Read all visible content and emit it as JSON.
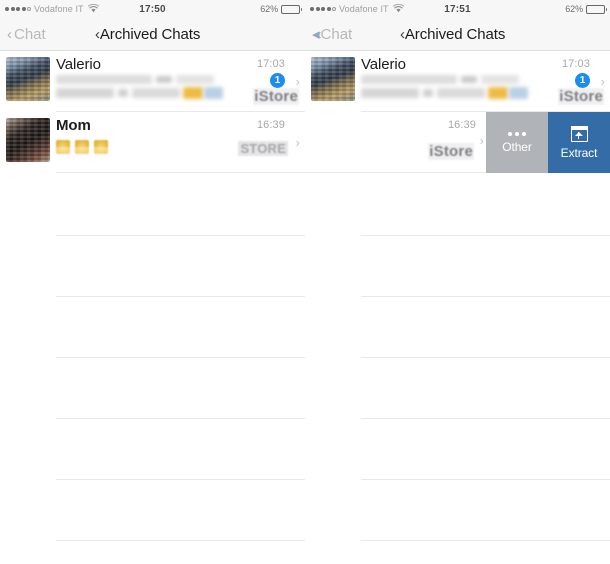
{
  "screens": [
    {
      "id": "left",
      "status_bar": {
        "signal_dots_filled": 4,
        "signal_dots_empty": 1,
        "carrier": "Vodafone IT",
        "wifi_icon": "wifi-icon",
        "time": "17:50",
        "battery_percent": "62%",
        "battery_level": 62
      },
      "nav_bar": {
        "back_label": "Chat",
        "back_icon": "chevron-left-icon",
        "title": "Archived Chats"
      },
      "rows": [
        {
          "name": "Valerio",
          "name_bold": false,
          "time": "17:03",
          "badge": "1",
          "preview_type": "blurred",
          "watermark": "iStore",
          "watermark_style": "lowercase",
          "chevron": "›",
          "swiped": false
        },
        {
          "name": "Mom",
          "name_bold": true,
          "time": "16:39",
          "badge": "",
          "preview_type": "emoji",
          "emoji_count": 3,
          "watermark": "STORE",
          "watermark_style": "uppercase",
          "chevron": "›",
          "swiped": false
        }
      ],
      "empty_separator_count": 6
    },
    {
      "id": "right",
      "status_bar": {
        "signal_dots_filled": 4,
        "signal_dots_empty": 1,
        "carrier": "Vodafone IT",
        "wifi_icon": "wifi-icon",
        "time": "17:51",
        "battery_percent": "62%",
        "battery_level": 62
      },
      "nav_bar": {
        "back_label": "Chat",
        "back_icon": "chevron-left-double-icon",
        "title": "Archived Chats"
      },
      "rows": [
        {
          "name": "Valerio",
          "name_bold": false,
          "time": "17:03",
          "badge": "1",
          "preview_type": "blurred",
          "watermark": "iStore",
          "watermark_style": "lowercase",
          "chevron": "›",
          "swiped": false
        },
        {
          "name": "",
          "name_bold": false,
          "time": "16:39",
          "badge": "",
          "preview_type": "none",
          "watermark": "iStore",
          "watermark_style": "lowercase",
          "chevron": "›",
          "swiped": true,
          "swipe_actions": [
            {
              "label": "Other",
              "icon": "ellipsis-icon",
              "color": "#b0b3b8"
            },
            {
              "label": "Extract",
              "icon": "unarchive-box-icon",
              "color": "#336ca6"
            }
          ]
        }
      ],
      "empty_separator_count": 6
    }
  ],
  "colors": {
    "badge_blue": "#1c8cf0",
    "extract_blue": "#336ca6",
    "other_gray": "#b0b3b8",
    "bar_gray": "#f7f7f7",
    "separator": "#e8e8e8",
    "emoji_yellow": "#f3c33c"
  }
}
